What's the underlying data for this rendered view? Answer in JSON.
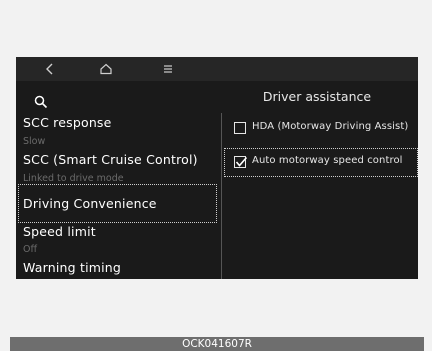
{
  "nav": {
    "back_icon": "chevron-left-icon",
    "home_icon": "home-icon",
    "menu_icon": "menu-icon"
  },
  "search": {
    "icon": "search-icon"
  },
  "left_menu": {
    "items": [
      {
        "title": "SCC response",
        "subtitle": "Slow"
      },
      {
        "title": "SCC (Smart Cruise Control)",
        "subtitle": "Linked to drive mode"
      },
      {
        "title": "Driving Convenience",
        "subtitle": "",
        "selected": true
      },
      {
        "title": "Speed limit",
        "subtitle": "Off"
      },
      {
        "title": "Warning timing",
        "subtitle": ""
      }
    ]
  },
  "right_panel": {
    "title": "Driver assistance",
    "options": [
      {
        "label": "HDA (Motorway Driving Assist)",
        "checked": false
      },
      {
        "label": "Auto motorway speed control",
        "checked": true,
        "focused": true
      }
    ]
  },
  "caption": "OCK041607R",
  "colors": {
    "screen_bg": "#1a1a1a",
    "topbar_bg": "#262626",
    "frame_border": "#cfcfcf",
    "caption_bg": "#6e6e6e"
  }
}
